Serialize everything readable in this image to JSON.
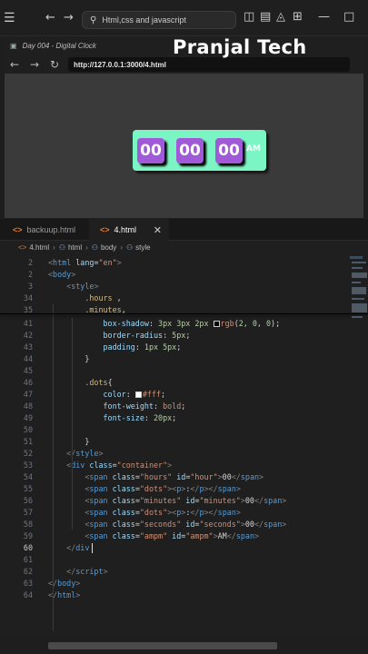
{
  "titlebar": {
    "search_text": "Html,css and javascript",
    "icons": [
      "menu-icon",
      "back-arrow-icon",
      "forward-arrow-icon",
      "search-icon",
      "layout-sidebar-icon",
      "layout-panel-icon",
      "layout-secondary-icon",
      "layout-grid-icon",
      "minimize-icon",
      "maximize-icon"
    ]
  },
  "browser": {
    "tab_title": "Day 004 - Digital Clock",
    "url": "http://127.0.0.1:3000/4.html",
    "brand": "Pranjal Tech",
    "clock": {
      "hours": "00",
      "minutes": "00",
      "seconds": "00",
      "ampm": "AM"
    },
    "colors": {
      "clock_bg": "#7cf5c4",
      "digit_bg": "#a05ad8",
      "text": "#ffffff"
    }
  },
  "editor": {
    "tabs": [
      {
        "label": "backuup.html",
        "active": false
      },
      {
        "label": "4.html",
        "active": true
      }
    ],
    "breadcrumb": [
      "4.html",
      "html",
      "body",
      "style"
    ],
    "lines": [
      {
        "n": "2",
        "tokens": [
          [
            "p",
            "<"
          ],
          [
            "t",
            "html"
          ],
          [
            "a",
            " lang"
          ],
          [
            "w",
            "="
          ],
          [
            "s",
            "\"en\""
          ],
          [
            "p",
            ">"
          ]
        ]
      },
      {
        "n": "2",
        "tokens": [
          [
            "p",
            "<"
          ],
          [
            "t",
            "body"
          ],
          [
            "p",
            ">"
          ]
        ]
      },
      {
        "n": "3",
        "tokens": [
          [
            "w",
            "    "
          ],
          [
            "p",
            "<"
          ],
          [
            "t",
            "style"
          ],
          [
            "p",
            ">"
          ]
        ]
      },
      {
        "n": "34",
        "tokens": [
          [
            "w",
            "        "
          ],
          [
            "c",
            ".hours"
          ],
          [
            "w",
            " ,"
          ]
        ]
      },
      {
        "n": "35",
        "tokens": [
          [
            "w",
            "        "
          ],
          [
            "c",
            ".minutes"
          ],
          [
            "w",
            ","
          ]
        ]
      },
      {
        "n": "41",
        "tokens": [
          [
            "w",
            "            "
          ],
          [
            "a",
            "box-shadow"
          ],
          [
            "w",
            ": "
          ],
          [
            "k",
            "3px 3px 2px "
          ],
          [
            "sw",
            "#020000"
          ],
          [
            "s",
            "rgb"
          ],
          [
            "w",
            "("
          ],
          [
            "k",
            "2, 0, 0"
          ],
          [
            "w",
            ");"
          ]
        ]
      },
      {
        "n": "42",
        "tokens": [
          [
            "w",
            "            "
          ],
          [
            "a",
            "border-radius"
          ],
          [
            "w",
            ": "
          ],
          [
            "k",
            "5px"
          ],
          [
            "w",
            ";"
          ]
        ]
      },
      {
        "n": "43",
        "tokens": [
          [
            "w",
            "            "
          ],
          [
            "a",
            "padding"
          ],
          [
            "w",
            ": "
          ],
          [
            "k",
            "1px 5px"
          ],
          [
            "w",
            ";"
          ]
        ]
      },
      {
        "n": "44",
        "tokens": [
          [
            "w",
            "        }"
          ]
        ]
      },
      {
        "n": "45",
        "tokens": []
      },
      {
        "n": "46",
        "tokens": [
          [
            "w",
            "        "
          ],
          [
            "c",
            ".dots"
          ],
          [
            "w",
            "{"
          ]
        ]
      },
      {
        "n": "47",
        "tokens": [
          [
            "w",
            "            "
          ],
          [
            "a",
            "color"
          ],
          [
            "w",
            ": "
          ],
          [
            "sw",
            "#ffffff"
          ],
          [
            "s",
            "#fff"
          ],
          [
            "w",
            ";"
          ]
        ]
      },
      {
        "n": "48",
        "tokens": [
          [
            "w",
            "            "
          ],
          [
            "a",
            "font-weight"
          ],
          [
            "w",
            ": "
          ],
          [
            "s",
            "bold"
          ],
          [
            "w",
            ";"
          ]
        ]
      },
      {
        "n": "49",
        "tokens": [
          [
            "w",
            "            "
          ],
          [
            "a",
            "font-size"
          ],
          [
            "w",
            ": "
          ],
          [
            "k",
            "20px"
          ],
          [
            "w",
            ";"
          ]
        ]
      },
      {
        "n": "50",
        "tokens": []
      },
      {
        "n": "51",
        "tokens": [
          [
            "w",
            "        }"
          ]
        ]
      },
      {
        "n": "52",
        "tokens": [
          [
            "w",
            "    "
          ],
          [
            "p",
            "</"
          ],
          [
            "t",
            "style"
          ],
          [
            "p",
            ">"
          ]
        ]
      },
      {
        "n": "53",
        "tokens": [
          [
            "w",
            "    "
          ],
          [
            "p",
            "<"
          ],
          [
            "t",
            "div"
          ],
          [
            "a",
            " class"
          ],
          [
            "w",
            "="
          ],
          [
            "s",
            "\"container\""
          ],
          [
            "p",
            ">"
          ]
        ]
      },
      {
        "n": "54",
        "tokens": [
          [
            "w",
            "        "
          ],
          [
            "p",
            "<"
          ],
          [
            "t",
            "span"
          ],
          [
            "a",
            " class"
          ],
          [
            "w",
            "="
          ],
          [
            "s",
            "\"hours\""
          ],
          [
            "a",
            " id"
          ],
          [
            "w",
            "="
          ],
          [
            "s",
            "\"hour\""
          ],
          [
            "p",
            ">"
          ],
          [
            "w",
            "00"
          ],
          [
            "p",
            "</"
          ],
          [
            "t",
            "span"
          ],
          [
            "p",
            ">"
          ]
        ]
      },
      {
        "n": "55",
        "tokens": [
          [
            "w",
            "        "
          ],
          [
            "p",
            "<"
          ],
          [
            "t",
            "span"
          ],
          [
            "a",
            " class"
          ],
          [
            "w",
            "="
          ],
          [
            "s",
            "\"dots\""
          ],
          [
            "p",
            "><"
          ],
          [
            "t",
            "p"
          ],
          [
            "p",
            ">"
          ],
          [
            "w",
            ":"
          ],
          [
            "p",
            "</"
          ],
          [
            "t",
            "p"
          ],
          [
            "p",
            "></"
          ],
          [
            "t",
            "span"
          ],
          [
            "p",
            ">"
          ]
        ]
      },
      {
        "n": "56",
        "tokens": [
          [
            "w",
            "        "
          ],
          [
            "p",
            "<"
          ],
          [
            "t",
            "span"
          ],
          [
            "a",
            " class"
          ],
          [
            "w",
            "="
          ],
          [
            "s",
            "\"minutes\""
          ],
          [
            "a",
            " id"
          ],
          [
            "w",
            "="
          ],
          [
            "s",
            "\"minutes\""
          ],
          [
            "p",
            ">"
          ],
          [
            "w",
            "00"
          ],
          [
            "p",
            "</"
          ],
          [
            "t",
            "span"
          ],
          [
            "p",
            ">"
          ]
        ]
      },
      {
        "n": "57",
        "tokens": [
          [
            "w",
            "        "
          ],
          [
            "p",
            "<"
          ],
          [
            "t",
            "span"
          ],
          [
            "a",
            " class"
          ],
          [
            "w",
            "="
          ],
          [
            "s",
            "\"dots\""
          ],
          [
            "p",
            "><"
          ],
          [
            "t",
            "p"
          ],
          [
            "p",
            ">"
          ],
          [
            "w",
            ":"
          ],
          [
            "p",
            "</"
          ],
          [
            "t",
            "p"
          ],
          [
            "p",
            "></"
          ],
          [
            "t",
            "span"
          ],
          [
            "p",
            ">"
          ]
        ]
      },
      {
        "n": "58",
        "tokens": [
          [
            "w",
            "        "
          ],
          [
            "p",
            "<"
          ],
          [
            "t",
            "span"
          ],
          [
            "a",
            " class"
          ],
          [
            "w",
            "="
          ],
          [
            "s",
            "\"seconds\""
          ],
          [
            "a",
            " id"
          ],
          [
            "w",
            "="
          ],
          [
            "s",
            "\"seconds\""
          ],
          [
            "p",
            ">"
          ],
          [
            "w",
            "00"
          ],
          [
            "p",
            "</"
          ],
          [
            "t",
            "span"
          ],
          [
            "p",
            ">"
          ]
        ]
      },
      {
        "n": "59",
        "tokens": [
          [
            "w",
            "        "
          ],
          [
            "p",
            "<"
          ],
          [
            "t",
            "span"
          ],
          [
            "a",
            " class"
          ],
          [
            "w",
            "="
          ],
          [
            "s",
            "\"ampm\""
          ],
          [
            "a",
            " id"
          ],
          [
            "w",
            "="
          ],
          [
            "s",
            "\"ampm\""
          ],
          [
            "p",
            ">"
          ],
          [
            "w",
            "AM"
          ],
          [
            "p",
            "</"
          ],
          [
            "t",
            "span"
          ],
          [
            "p",
            ">"
          ]
        ]
      },
      {
        "n": "60",
        "tokens": [
          [
            "w",
            "    "
          ],
          [
            "p",
            "</"
          ],
          [
            "t",
            "div"
          ]
        ]
      },
      {
        "n": "61",
        "tokens": []
      },
      {
        "n": "62",
        "tokens": [
          [
            "w",
            "    "
          ],
          [
            "p",
            "</"
          ],
          [
            "t",
            "script"
          ],
          [
            "p",
            ">"
          ]
        ]
      },
      {
        "n": "63",
        "tokens": [
          [
            "p",
            "</"
          ],
          [
            "t",
            "body"
          ],
          [
            "p",
            ">"
          ]
        ]
      },
      {
        "n": "64",
        "tokens": [
          [
            "p",
            "</"
          ],
          [
            "t",
            "html"
          ],
          [
            "p",
            ">"
          ]
        ]
      }
    ],
    "current_line": "60"
  }
}
